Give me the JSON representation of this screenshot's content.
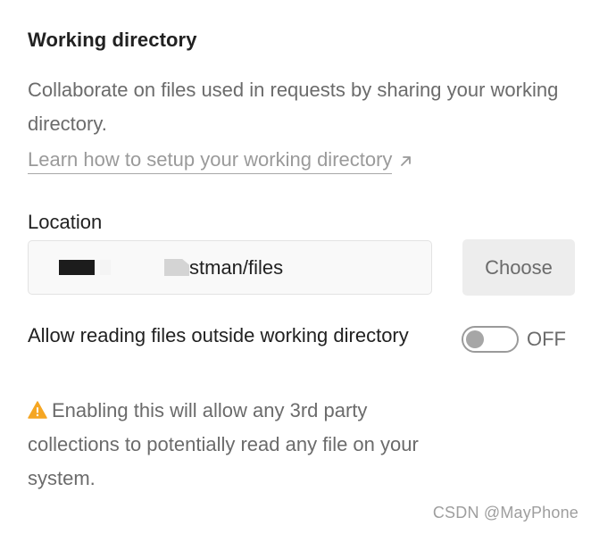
{
  "section": {
    "title": "Working directory",
    "description": "Collaborate on files used in requests by sharing your working directory.",
    "learn_link": "Learn how to setup your working directory"
  },
  "location": {
    "label": "Location",
    "value_visible": "stman/files",
    "choose_label": "Choose"
  },
  "outside_files": {
    "label": "Allow reading files outside working directory",
    "toggle_state": "OFF",
    "warning": "Enabling this will allow any 3rd party collections to potentially read any file on your system."
  },
  "watermark": "CSDN @MayPhone",
  "colors": {
    "warning_icon": "#f5a623",
    "text_primary": "#212121",
    "text_secondary": "#6b6b6b"
  },
  "icons": {
    "link": "arrow-up-right-icon",
    "warning": "warning-triangle-icon"
  }
}
